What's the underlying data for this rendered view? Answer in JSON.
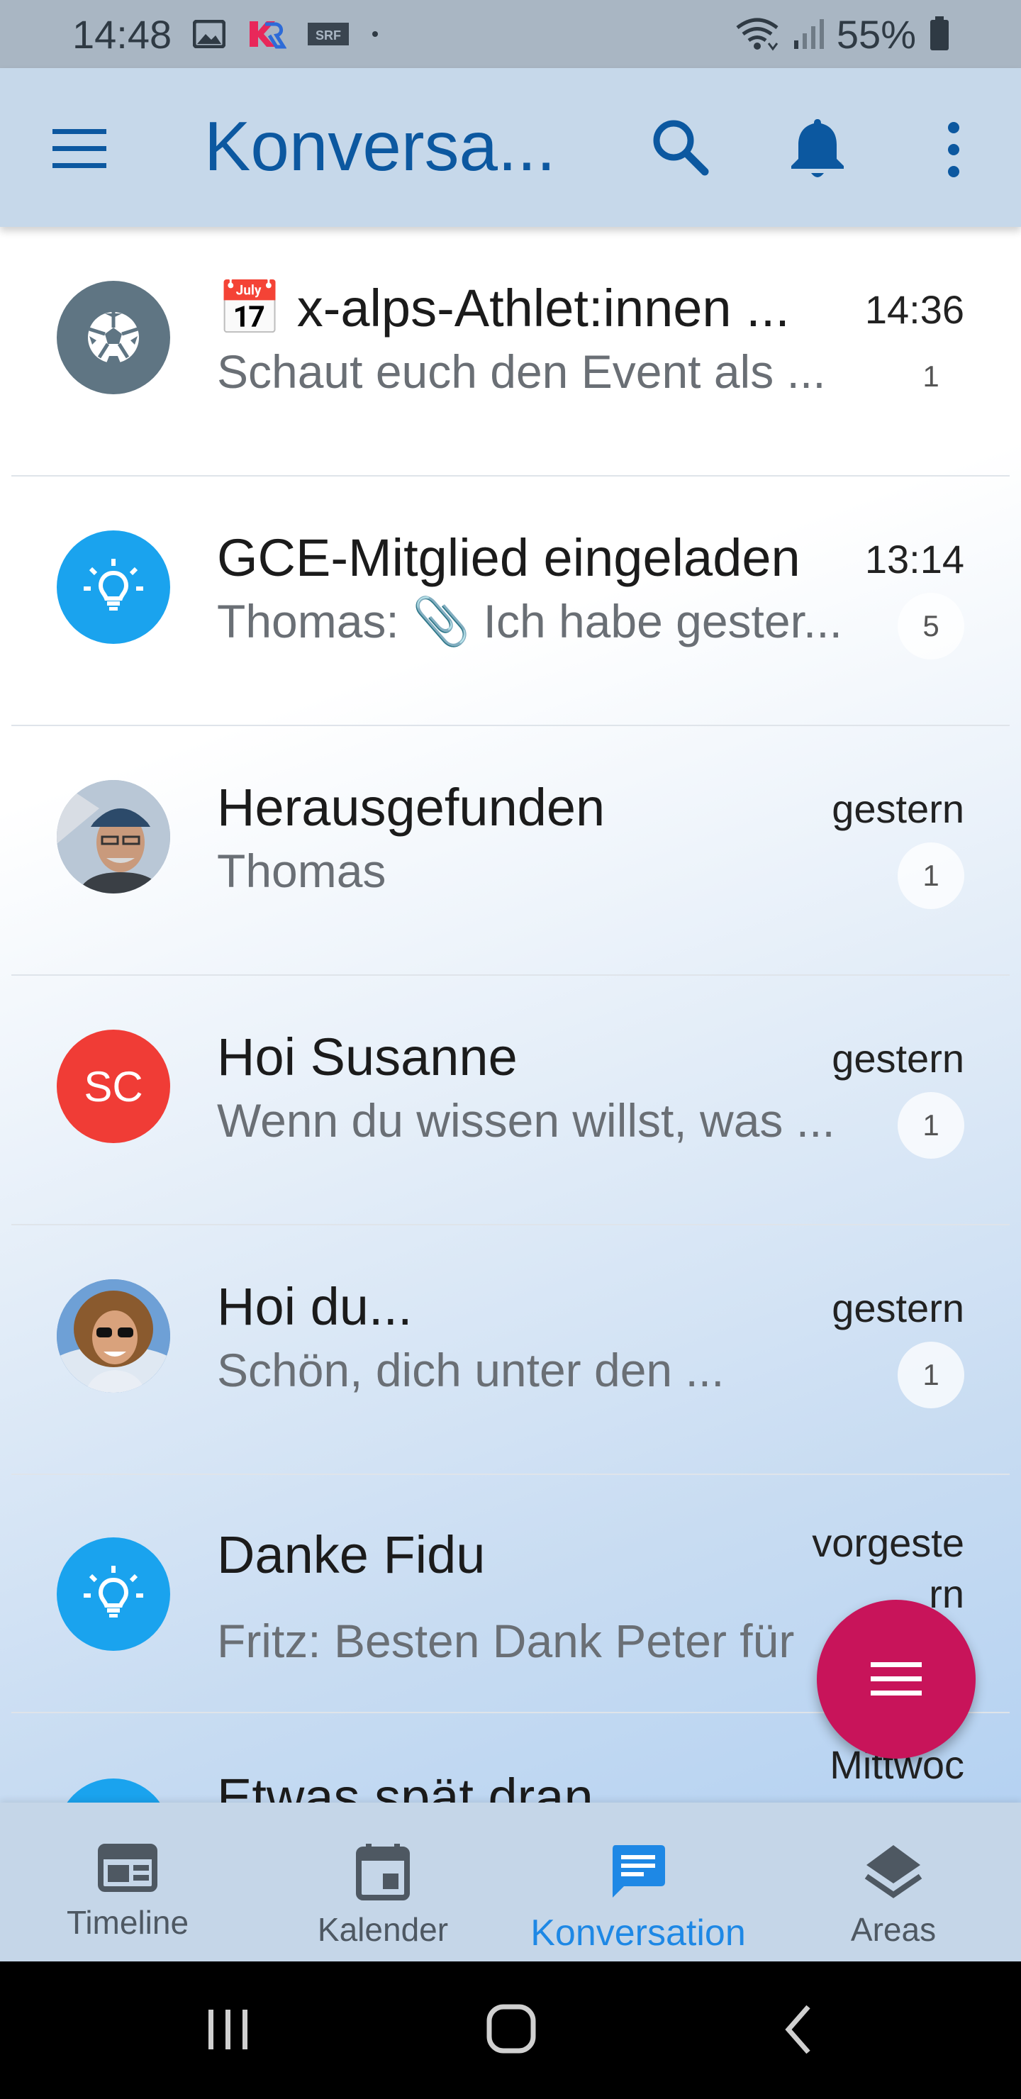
{
  "status_bar": {
    "time": "14:48",
    "battery": "55%",
    "icons": [
      "image-icon",
      "kr-app-icon",
      "srf-app-icon",
      "dot-icon",
      "wifi-icon",
      "signal-icon",
      "battery-icon"
    ]
  },
  "app_bar": {
    "title": "Konversa...",
    "icons": [
      "menu-icon",
      "search-icon",
      "bell-icon",
      "more-vert-icon"
    ]
  },
  "conversations": [
    {
      "title": "📅 x-alps-Athlet:innen ...",
      "subtitle": "Schaut euch den Event als ...",
      "time": "14:36",
      "badge": "1",
      "avatar": "soccer-ball-icon",
      "avatar_color": "#5f7583"
    },
    {
      "title": "GCE-Mitglied eingeladen",
      "subtitle": "Thomas: 📎 Ich habe gester...",
      "time": "13:14",
      "badge": "5",
      "avatar": "lightbulb-icon",
      "avatar_color": "#1aa3ee"
    },
    {
      "title": "Herausgefunden",
      "subtitle": "Thomas",
      "time": "gestern",
      "badge": "1",
      "avatar": "photo-man-cap",
      "avatar_color": "#7a8aa0"
    },
    {
      "title": "Hoi Susanne",
      "subtitle": "Wenn du wissen willst, was ...",
      "time": "gestern",
      "badge": "1",
      "avatar_initials": "SC",
      "avatar_color": "#f03c36"
    },
    {
      "title": "Hoi du...",
      "subtitle": "Schön, dich unter den ...",
      "time": "gestern",
      "badge": "1",
      "avatar": "photo-woman-sunglasses",
      "avatar_color": "#4a7fb8"
    },
    {
      "title": "Danke Fidu",
      "subtitle": "Fritz: Besten Dank Peter für",
      "time": "vorgeste\nrn",
      "badge": "",
      "avatar": "lightbulb-icon",
      "avatar_color": "#1aa3ee"
    },
    {
      "title": "Etwas spät dran",
      "subtitle": "",
      "time": "Mittwoc",
      "badge": "",
      "avatar": "lightbulb-icon",
      "avatar_color": "#1aa3ee"
    }
  ],
  "fab": {
    "icon": "menu-lines-icon",
    "color": "#c8145a"
  },
  "bottom_nav": [
    {
      "label": "Timeline",
      "icon": "timeline-icon",
      "active": false
    },
    {
      "label": "Kalender",
      "icon": "calendar-icon",
      "active": false
    },
    {
      "label": "Konversation",
      "icon": "chat-icon",
      "active": true
    },
    {
      "label": "Areas",
      "icon": "layers-icon",
      "active": false
    }
  ],
  "colors": {
    "accent": "#1e88e5",
    "title_blue": "#0c58a0",
    "appbar": "#c6d8ea"
  }
}
